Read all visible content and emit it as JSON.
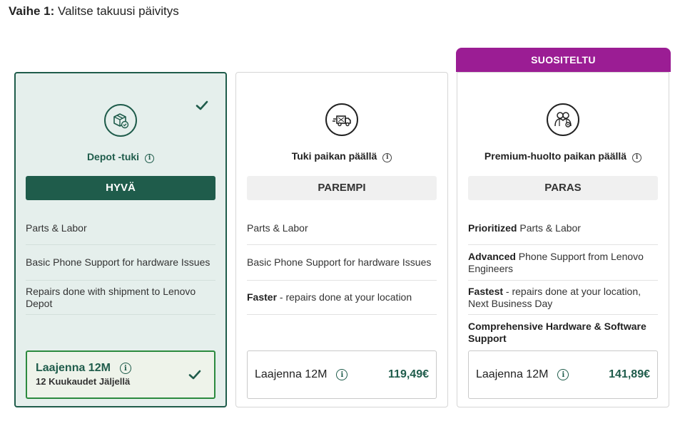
{
  "page": {
    "step_label": "Vaihe 1:",
    "step_title": "Valitse takuusi päivitys"
  },
  "ribbon": {
    "label": "SUOSITELTU",
    "color": "#9b1d94"
  },
  "colors": {
    "accent": "#1f5c4b",
    "selected_bg": "#e5efec",
    "selected_ext_border": "#2b8a3e"
  },
  "plans": [
    {
      "icon": "package-icon",
      "name": "Depot -tuki",
      "tier": "HYVÄ",
      "selected": true,
      "features": [
        {
          "bold": "",
          "text": "Parts & Labor"
        },
        {
          "bold": "",
          "text": "Basic Phone Support for hardware Issues"
        },
        {
          "bold": "",
          "text": "Repairs done with shipment to Lenovo Depot"
        }
      ],
      "extension": {
        "label": "Laajenna 12M",
        "remaining": "12 Kuukaudet Jäljellä"
      }
    },
    {
      "icon": "truck-icon",
      "name": "Tuki paikan päällä",
      "tier": "PAREMPI",
      "selected": false,
      "features": [
        {
          "bold": "",
          "text": "Parts & Labor"
        },
        {
          "bold": "",
          "text": "Basic Phone Support for hardware Issues"
        },
        {
          "bold": "Faster",
          "text": " - repairs done at your location"
        }
      ],
      "extension": {
        "label": "Laajenna 12M",
        "price": "119,49€"
      }
    },
    {
      "icon": "technician-icon",
      "name": "Premium-huolto paikan päällä",
      "tier": "PARAS",
      "selected": false,
      "features": [
        {
          "bold": "Prioritized",
          "text": " Parts & Labor"
        },
        {
          "bold": "Advanced",
          "text": " Phone Support from Lenovo Engineers"
        },
        {
          "bold": "Fastest",
          "text": " - repairs done at your location, Next Business Day"
        },
        {
          "bold": "Comprehensive Hardware & Software Support",
          "text": ""
        }
      ],
      "extension": {
        "label": "Laajenna 12M",
        "price": "141,89€"
      }
    }
  ]
}
